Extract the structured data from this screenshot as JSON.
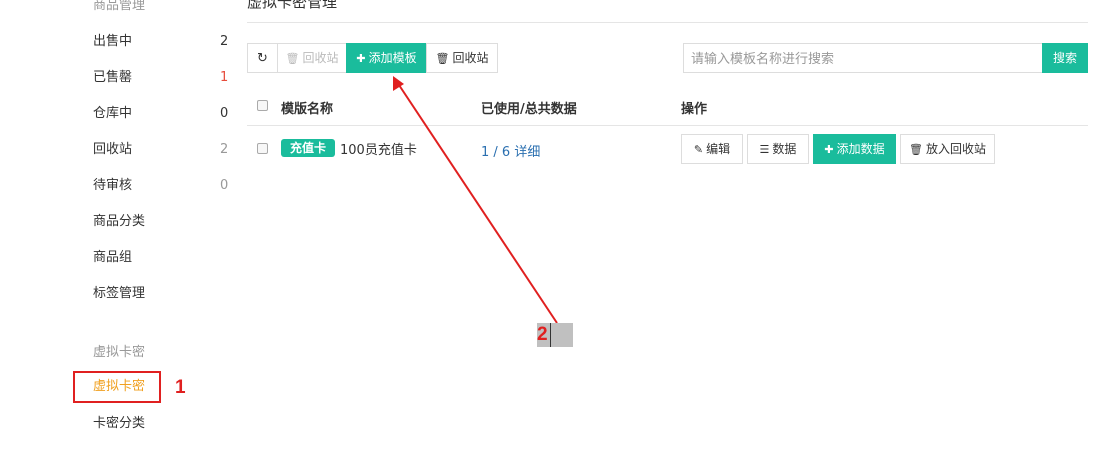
{
  "sidebar": {
    "goods_heading": "商品管理",
    "items": [
      {
        "label": "出售中",
        "count": "2"
      },
      {
        "label": "已售罄",
        "count": "1"
      },
      {
        "label": "仓库中",
        "count": "0"
      },
      {
        "label": "回收站",
        "count": "2"
      },
      {
        "label": "待审核",
        "count": "0"
      },
      {
        "label": "商品分类"
      },
      {
        "label": "商品组"
      },
      {
        "label": "标签管理"
      }
    ],
    "virtual_heading": "虚拟卡密",
    "virtual_items": [
      {
        "label": "虚拟卡密",
        "active": true
      },
      {
        "label": "卡密分类"
      }
    ]
  },
  "page_title": "虚拟卡密管理",
  "toolbar": {
    "refresh_icon": "refresh-icon",
    "recycle_disabled": "回收站",
    "add_template": "添加模板",
    "recycle": "回收站"
  },
  "search": {
    "placeholder": "请输入模板名称进行搜索",
    "button": "搜索"
  },
  "table": {
    "headers": [
      "模版名称",
      "已使用/总共数据",
      "操作"
    ],
    "rows": [
      {
        "tag": "充值卡",
        "name": "100员充值卡",
        "usage": "1 / 6",
        "detail": "详细",
        "actions": {
          "edit": "编辑",
          "data": "数据",
          "add_data": "添加数据",
          "to_recycle": "放入回收站"
        }
      }
    ]
  },
  "annotations": {
    "step1": "1",
    "step2": "2"
  },
  "colors": {
    "primary": "#1abc9c",
    "active_menu": "#f0a020",
    "annotation_red": "#e02020",
    "link": "#2a6fb0"
  }
}
